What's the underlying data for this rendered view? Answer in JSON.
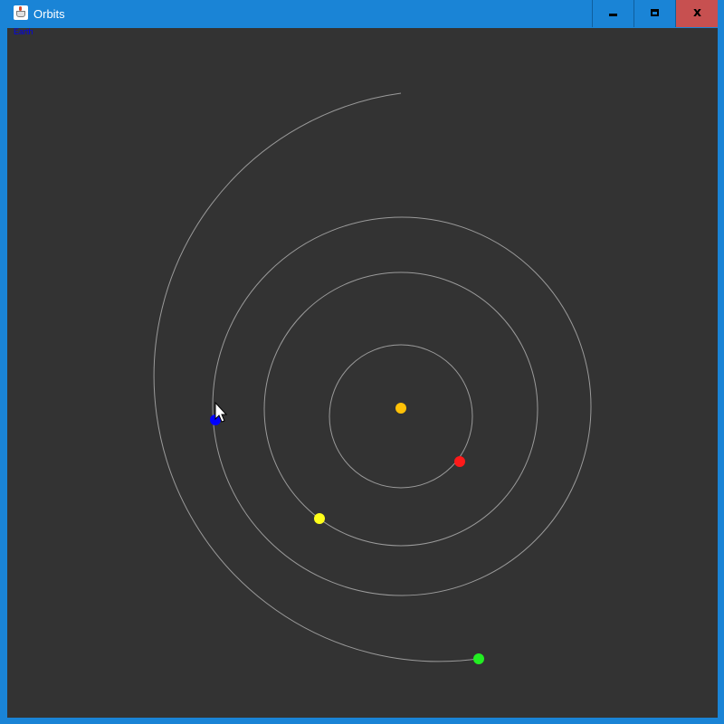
{
  "window": {
    "title": "Orbits",
    "app_icon": "java-cup-icon",
    "controls": {
      "minimize": "minimize-icon",
      "maximize": "maximize-icon",
      "close": "close-icon",
      "close_glyph": "x"
    }
  },
  "canvas": {
    "background": "#333333",
    "label": "Earth",
    "label_color": "#0000ee",
    "orbit_color": "#9a9a9a",
    "sun": {
      "name": "sun",
      "color": "#ffc107"
    },
    "planets": [
      {
        "name": "red-planet",
        "color": "#ff1a1a"
      },
      {
        "name": "yellow-planet",
        "color": "#ffff1a"
      },
      {
        "name": "blue-planet",
        "color": "#0000ff"
      },
      {
        "name": "green-planet",
        "color": "#22ee22"
      }
    ],
    "cursor": "pointer-cursor-icon"
  }
}
